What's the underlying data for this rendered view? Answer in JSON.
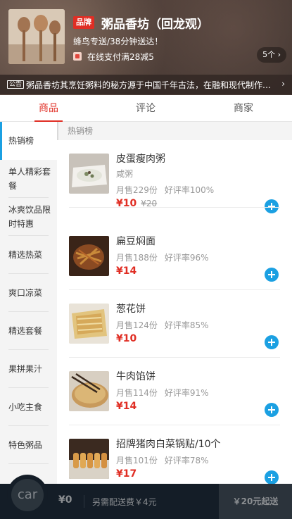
{
  "shop": {
    "brand_tag": "品牌",
    "name": "粥品香坊（回龙观）",
    "delivery": "蜂鸟专送/38分钟送达！",
    "promo": "在线支付满28减5",
    "promo_count": "5个 ›",
    "notice_tag": "公告",
    "notice": "粥品香坊其烹饪粥料的秘方源于中国千年古法，在融和现代制作…",
    "notice_arrow": "›"
  },
  "tabs": [
    {
      "label": "商品",
      "active": true
    },
    {
      "label": "评论",
      "active": false
    },
    {
      "label": "商家",
      "active": false
    }
  ],
  "sidebar": {
    "items": [
      {
        "label": "热销榜",
        "active": true
      },
      {
        "label": "单人精彩套餐"
      },
      {
        "label": "冰爽饮品限时特惠"
      },
      {
        "label": "精选热菜"
      },
      {
        "label": "爽口凉菜"
      },
      {
        "label": "精选套餐"
      },
      {
        "label": "果拼果汁"
      },
      {
        "label": "小吃主食"
      },
      {
        "label": "特色粥品"
      }
    ]
  },
  "section": {
    "title": "热销榜"
  },
  "items": [
    {
      "name": "皮蛋瘦肉粥",
      "desc": "咸粥",
      "sales": "月售229份",
      "rating": "好评率100%",
      "price": "¥10",
      "old_price": "¥20"
    },
    {
      "name": "扁豆焖面",
      "desc": "",
      "sales": "月售188份",
      "rating": "好评率96%",
      "price": "¥14",
      "old_price": ""
    },
    {
      "name": "葱花饼",
      "desc": "",
      "sales": "月售124份",
      "rating": "好评率85%",
      "price": "¥10",
      "old_price": ""
    },
    {
      "name": "牛肉馅饼",
      "desc": "",
      "sales": "月售114份",
      "rating": "好评率91%",
      "price": "¥14",
      "old_price": ""
    },
    {
      "name": "招牌猪肉白菜锅贴/10个",
      "desc": "",
      "sales": "月售101份",
      "rating": "好评率78%",
      "price": "¥17",
      "old_price": ""
    }
  ],
  "cart": {
    "icon_text": "car",
    "total": "¥0",
    "delivery_fee": "另需配送费￥4元",
    "min_order": "￥20元起送"
  },
  "colors": {
    "accent": "#e02e24",
    "add_button": "#1ba0e2",
    "cart_bar": "#141d27"
  },
  "icons": {
    "add": "plus-circle-icon",
    "promo": "discount-icon",
    "cart": "cart-icon"
  }
}
